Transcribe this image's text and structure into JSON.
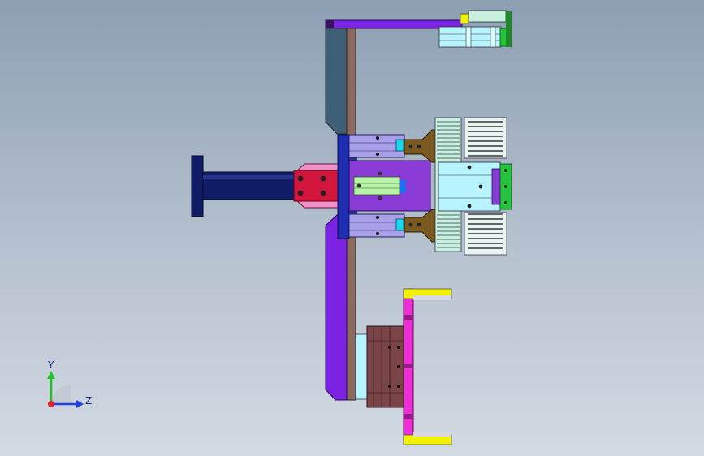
{
  "viewport": {
    "background_top": "#8d9fb3",
    "background_bottom": "#d3dae3"
  },
  "triad": {
    "y_label": "Y",
    "z_label": "Z",
    "x_color": "#e0202a",
    "y_color": "#22c02a",
    "z_color": "#1f3fe0"
  },
  "colors": {
    "purple": "#7b22e3",
    "violet": "#8a3bd6",
    "slate": "#3f5f77",
    "rail_brown": "#8a6a62",
    "navy": "#101d66",
    "crimson": "#d3163e",
    "pink": "#f090c8",
    "magenta": "#ee2fd6",
    "yellow": "#f2f200",
    "mint": "#c8f0e0",
    "cyan_light": "#b8f4ff",
    "green": "#25c53b",
    "lavender": "#a8a0e8",
    "olive": "#7a5a20",
    "maroon": "#7a4448"
  }
}
